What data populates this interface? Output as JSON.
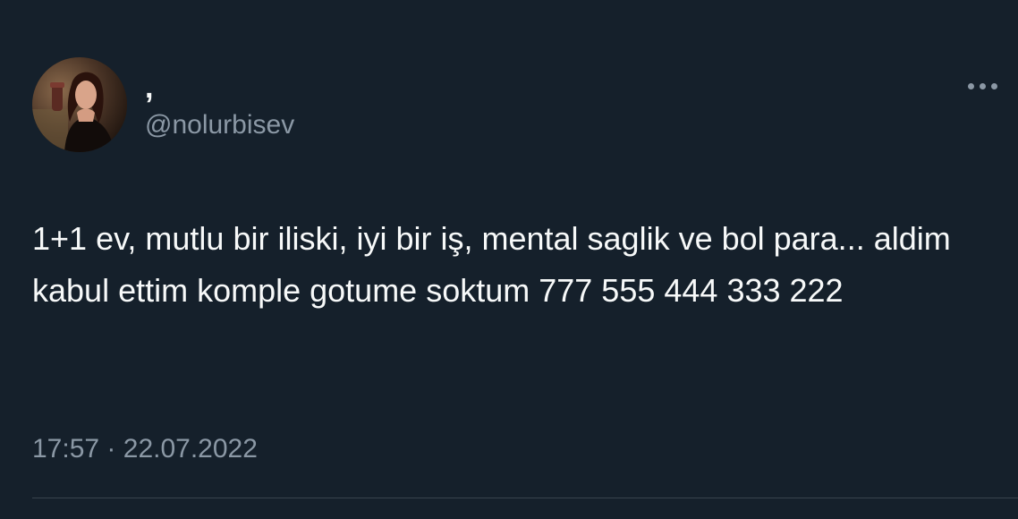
{
  "tweet": {
    "author": {
      "display_name": ",",
      "handle": "@nolurbisev",
      "avatar": "profile-photo"
    },
    "text": "1+1 ev, mutlu bir iliski, iyi bir iş, mental saglik ve bol para... aldim kabul ettim komple gotume soktum 777 555 444 333 222",
    "time": "17:57",
    "separator": "·",
    "date": "22.07.2022",
    "more_icon": "more-options-icon"
  },
  "colors": {
    "background": "#15202b",
    "text_primary": "#f7f9f9",
    "text_secondary": "#8b98a5",
    "divider": "#38444d"
  }
}
